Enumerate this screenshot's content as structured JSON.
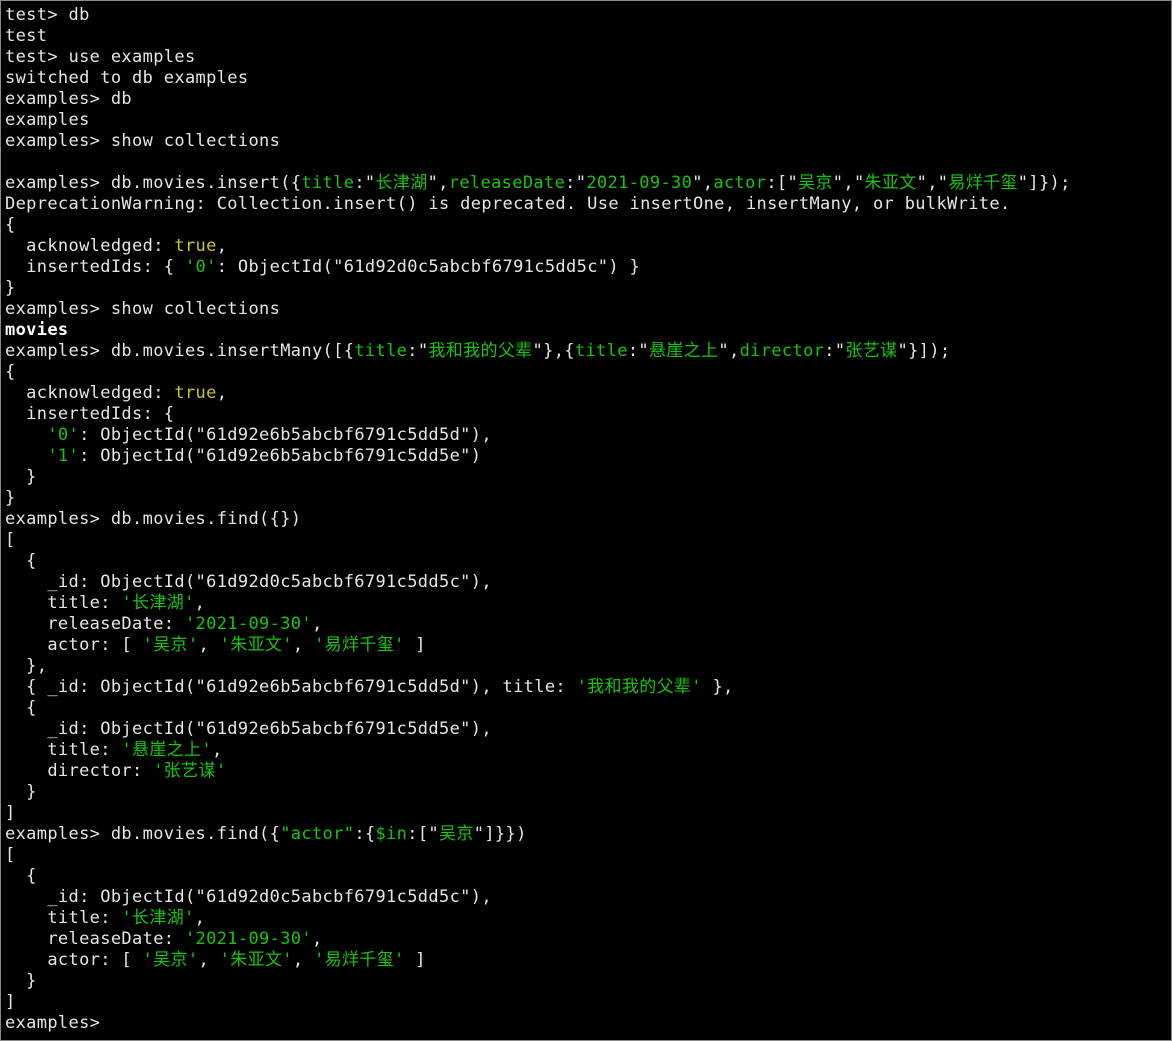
{
  "terminal": {
    "lines": [
      [
        {
          "t": "test> db"
        }
      ],
      [
        {
          "t": "test"
        }
      ],
      [
        {
          "t": "test> use examples"
        }
      ],
      [
        {
          "t": "switched to db examples"
        }
      ],
      [
        {
          "t": "examples> db"
        }
      ],
      [
        {
          "t": "examples"
        }
      ],
      [
        {
          "t": "examples> show collections"
        }
      ],
      [],
      [
        {
          "t": "examples> db.movies.insert({"
        },
        {
          "t": "title",
          "c": "g"
        },
        {
          "t": ":\""
        },
        {
          "t": "长津湖",
          "c": "g"
        },
        {
          "t": "\","
        },
        {
          "t": "releaseDate",
          "c": "g"
        },
        {
          "t": ":\""
        },
        {
          "t": "2021-09-30",
          "c": "g"
        },
        {
          "t": "\","
        },
        {
          "t": "actor",
          "c": "g"
        },
        {
          "t": ":[\""
        },
        {
          "t": "吴京",
          "c": "g"
        },
        {
          "t": "\",\""
        },
        {
          "t": "朱亚文",
          "c": "g"
        },
        {
          "t": "\",\""
        },
        {
          "t": "易烊千玺",
          "c": "g"
        },
        {
          "t": "\"]});"
        }
      ],
      [
        {
          "t": "DeprecationWarning: Collection.insert() is deprecated. Use insertOne, insertMany, or bulkWrite."
        }
      ],
      [
        {
          "t": "{"
        }
      ],
      [
        {
          "t": "  acknowledged: "
        },
        {
          "t": "true",
          "c": "y"
        },
        {
          "t": ","
        }
      ],
      [
        {
          "t": "  insertedIds: { "
        },
        {
          "t": "'0'",
          "c": "g"
        },
        {
          "t": ": ObjectId(\"61d92d0c5abcbf6791c5dd5c\") }"
        }
      ],
      [
        {
          "t": "}"
        }
      ],
      [
        {
          "t": "examples> show collections"
        }
      ],
      [
        {
          "t": "movies",
          "c": "bold"
        }
      ],
      [
        {
          "t": "examples> db.movies.insertMany([{"
        },
        {
          "t": "title",
          "c": "g"
        },
        {
          "t": ":\""
        },
        {
          "t": "我和我的父辈",
          "c": "g"
        },
        {
          "t": "\"},{"
        },
        {
          "t": "title",
          "c": "g"
        },
        {
          "t": ":\""
        },
        {
          "t": "悬崖之上",
          "c": "g"
        },
        {
          "t": "\","
        },
        {
          "t": "director",
          "c": "g"
        },
        {
          "t": ":\""
        },
        {
          "t": "张艺谋",
          "c": "g"
        },
        {
          "t": "\"}]);"
        }
      ],
      [
        {
          "t": "{"
        }
      ],
      [
        {
          "t": "  acknowledged: "
        },
        {
          "t": "true",
          "c": "y"
        },
        {
          "t": ","
        }
      ],
      [
        {
          "t": "  insertedIds: {"
        }
      ],
      [
        {
          "t": "    "
        },
        {
          "t": "'0'",
          "c": "g"
        },
        {
          "t": ": ObjectId(\"61d92e6b5abcbf6791c5dd5d\"),"
        }
      ],
      [
        {
          "t": "    "
        },
        {
          "t": "'1'",
          "c": "g"
        },
        {
          "t": ": ObjectId(\"61d92e6b5abcbf6791c5dd5e\")"
        }
      ],
      [
        {
          "t": "  }"
        }
      ],
      [
        {
          "t": "}"
        }
      ],
      [
        {
          "t": "examples> db.movies.find({})"
        }
      ],
      [
        {
          "t": "["
        }
      ],
      [
        {
          "t": "  {"
        }
      ],
      [
        {
          "t": "    _id: ObjectId(\"61d92d0c5abcbf6791c5dd5c\"),"
        }
      ],
      [
        {
          "t": "    title: "
        },
        {
          "t": "'长津湖'",
          "c": "g"
        },
        {
          "t": ","
        }
      ],
      [
        {
          "t": "    releaseDate: "
        },
        {
          "t": "'2021-09-30'",
          "c": "g"
        },
        {
          "t": ","
        }
      ],
      [
        {
          "t": "    actor: [ "
        },
        {
          "t": "'吴京'",
          "c": "g"
        },
        {
          "t": ", "
        },
        {
          "t": "'朱亚文'",
          "c": "g"
        },
        {
          "t": ", "
        },
        {
          "t": "'易烊千玺'",
          "c": "g"
        },
        {
          "t": " ]"
        }
      ],
      [
        {
          "t": "  },"
        }
      ],
      [
        {
          "t": "  { _id: ObjectId(\"61d92e6b5abcbf6791c5dd5d\"), title: "
        },
        {
          "t": "'我和我的父辈'",
          "c": "g"
        },
        {
          "t": " },"
        }
      ],
      [
        {
          "t": "  {"
        }
      ],
      [
        {
          "t": "    _id: ObjectId(\"61d92e6b5abcbf6791c5dd5e\"),"
        }
      ],
      [
        {
          "t": "    title: "
        },
        {
          "t": "'悬崖之上'",
          "c": "g"
        },
        {
          "t": ","
        }
      ],
      [
        {
          "t": "    director: "
        },
        {
          "t": "'张艺谋'",
          "c": "g"
        }
      ],
      [
        {
          "t": "  }"
        }
      ],
      [
        {
          "t": "]"
        }
      ],
      [
        {
          "t": "examples> db.movies.find({"
        },
        {
          "t": "\"actor\"",
          "c": "g"
        },
        {
          "t": ":{"
        },
        {
          "t": "$in",
          "c": "g"
        },
        {
          "t": ":[\""
        },
        {
          "t": "吴京",
          "c": "g"
        },
        {
          "t": "\"]}})"
        }
      ],
      [
        {
          "t": "["
        }
      ],
      [
        {
          "t": "  {"
        }
      ],
      [
        {
          "t": "    _id: ObjectId(\"61d92d0c5abcbf6791c5dd5c\"),"
        }
      ],
      [
        {
          "t": "    title: "
        },
        {
          "t": "'长津湖'",
          "c": "g"
        },
        {
          "t": ","
        }
      ],
      [
        {
          "t": "    releaseDate: "
        },
        {
          "t": "'2021-09-30'",
          "c": "g"
        },
        {
          "t": ","
        }
      ],
      [
        {
          "t": "    actor: [ "
        },
        {
          "t": "'吴京'",
          "c": "g"
        },
        {
          "t": ", "
        },
        {
          "t": "'朱亚文'",
          "c": "g"
        },
        {
          "t": ", "
        },
        {
          "t": "'易烊千玺'",
          "c": "g"
        },
        {
          "t": " ]"
        }
      ],
      [
        {
          "t": "  }"
        }
      ],
      [
        {
          "t": "]"
        }
      ],
      [
        {
          "t": "examples> "
        }
      ]
    ]
  },
  "colors": {
    "background": "#000000",
    "text": "#e6e6e6",
    "string": "#16c60c",
    "boolean": "#c7c431",
    "border": "#8a8a8a"
  }
}
